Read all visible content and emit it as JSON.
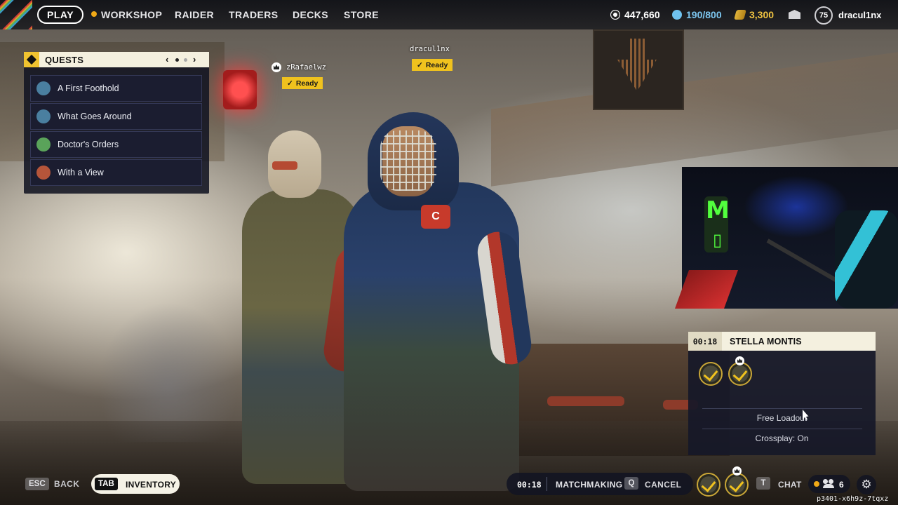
{
  "nav": {
    "play": "PLAY",
    "items": [
      "WORKSHOP",
      "RAIDER",
      "TRADERS",
      "DECKS",
      "STORE"
    ]
  },
  "resources": {
    "coins": "447,660",
    "raider_tokens": "190/800",
    "cred": "3,300"
  },
  "profile": {
    "level": "75",
    "username": "dracul1nx"
  },
  "quests": {
    "title": "QUESTS",
    "prev": "‹",
    "next": "›",
    "items": [
      {
        "label": "A First Foothold",
        "icon_color": "#4a7fa0"
      },
      {
        "label": "What Goes Around",
        "icon_color": "#4a7fa0"
      },
      {
        "label": "Doctor's Orders",
        "icon_color": "#5aa35a"
      },
      {
        "label": "With a View",
        "icon_color": "#b5553a"
      }
    ]
  },
  "players": [
    {
      "name": "zRafaelwz",
      "status": "Ready",
      "leader": true
    },
    {
      "name": "dracul1nx",
      "status": "Ready",
      "leader": false
    }
  ],
  "lobby": {
    "timer": "00:18",
    "map": "STELLA MONTIS",
    "loadout": "Free Loadout",
    "crossplay": "Crossplay: On"
  },
  "bottom": {
    "esc_key": "ESC",
    "back": "BACK",
    "tab_key": "TAB",
    "inventory": "INVENTORY",
    "mm_timer": "00:18",
    "matchmaking": "MATCHMAKING",
    "cancel_key": "Q",
    "cancel": "CANCEL",
    "chat_key": "T",
    "chat": "CHAT",
    "friends_count": "6",
    "session_id": "p3401-x6h9z-7tqxz"
  },
  "colors": {
    "accent": "#f0c21e",
    "panel": "#121422",
    "ready": "#f0c21e"
  }
}
